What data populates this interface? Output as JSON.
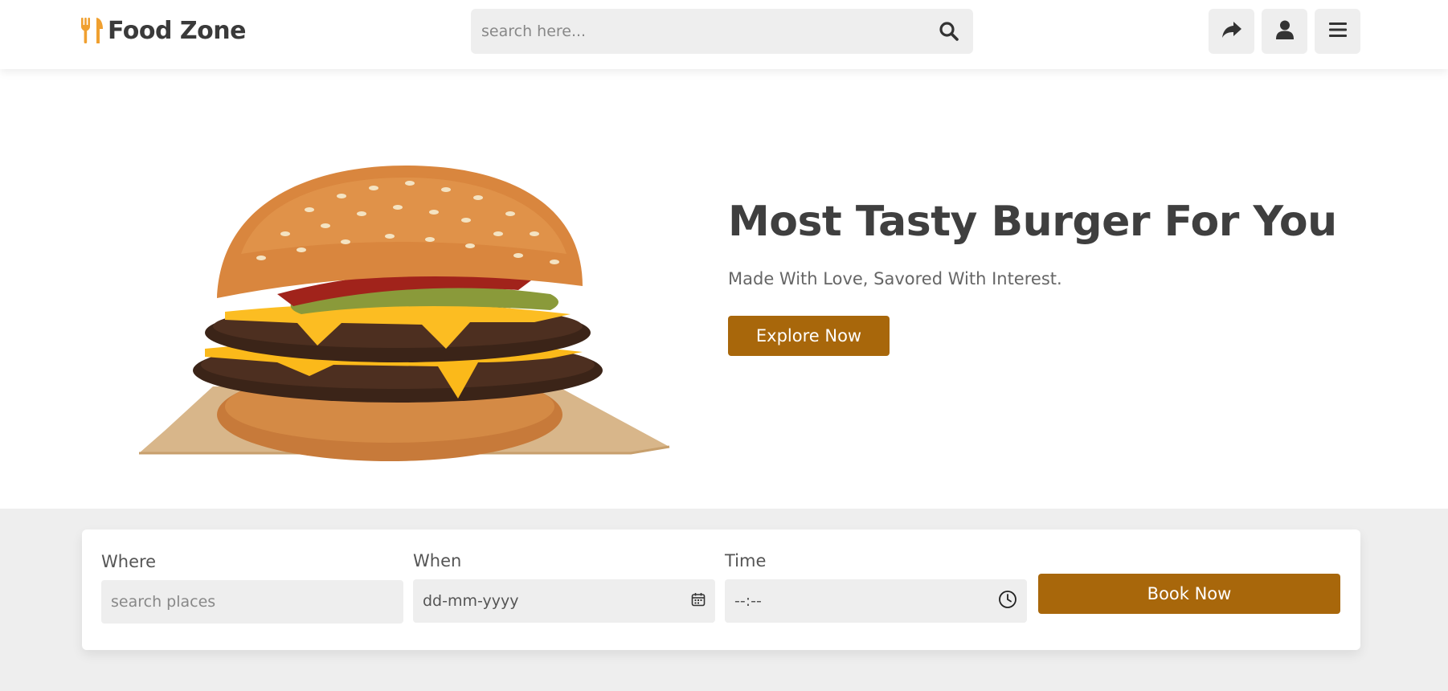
{
  "header": {
    "logo_text": "Food Zone",
    "logo_icon": "utensils-icon",
    "search_placeholder": "search here...",
    "buttons": [
      "share-icon",
      "user-icon",
      "menu-icon"
    ]
  },
  "hero": {
    "title": "Most Tasty Burger For You",
    "subtitle": "Made With Love, Savored With Interest.",
    "cta_label": "Explore Now",
    "image": "burger-image"
  },
  "booking": {
    "where_label": "Where",
    "where_placeholder": "search places",
    "when_label": "When",
    "when_placeholder": "dd-mm-yyyy",
    "time_label": "Time",
    "time_placeholder": "--:--",
    "book_label": "Book Now"
  },
  "colors": {
    "accent": "#a8670b",
    "logo_icon": "#f0a030",
    "field_bg": "#eeeeee",
    "text_dark": "#3f3f3f"
  }
}
